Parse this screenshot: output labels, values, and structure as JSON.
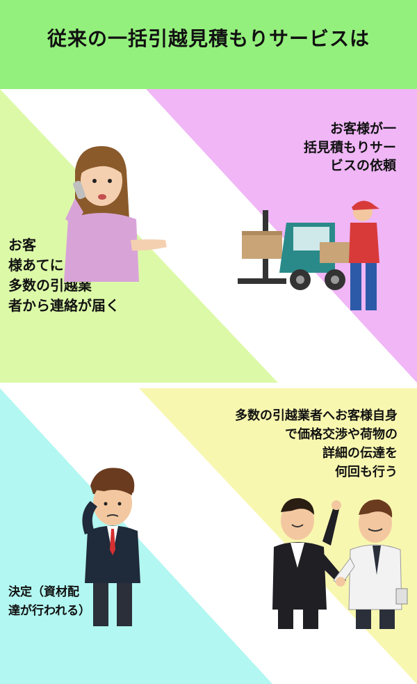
{
  "header": {
    "title": "従来の一括引越見積もりサービスは"
  },
  "steps": [
    {
      "text": "お客様が一\n括見積もりサー\nビスの依頼"
    },
    {
      "text": "お客\n様あてに\n多数の引越業\n者から連絡が届く"
    },
    {
      "text": "多数の引越業者へお客様自身\nで価格交渉や荷物の\n詳細の伝達を\n何回も行う"
    },
    {
      "text": "決定（資材配\n達が行われる）"
    }
  ],
  "colors": {
    "header": "#94f07d",
    "pink": "#f0b6f6",
    "green": "#dcf9a8",
    "yellow": "#f8f7b0",
    "cyan": "#b2f7f1"
  },
  "icons": [
    "woman-phone-illustration",
    "forklift-mover-illustration",
    "businessmen-handshake-illustration",
    "confused-businessman-illustration"
  ]
}
